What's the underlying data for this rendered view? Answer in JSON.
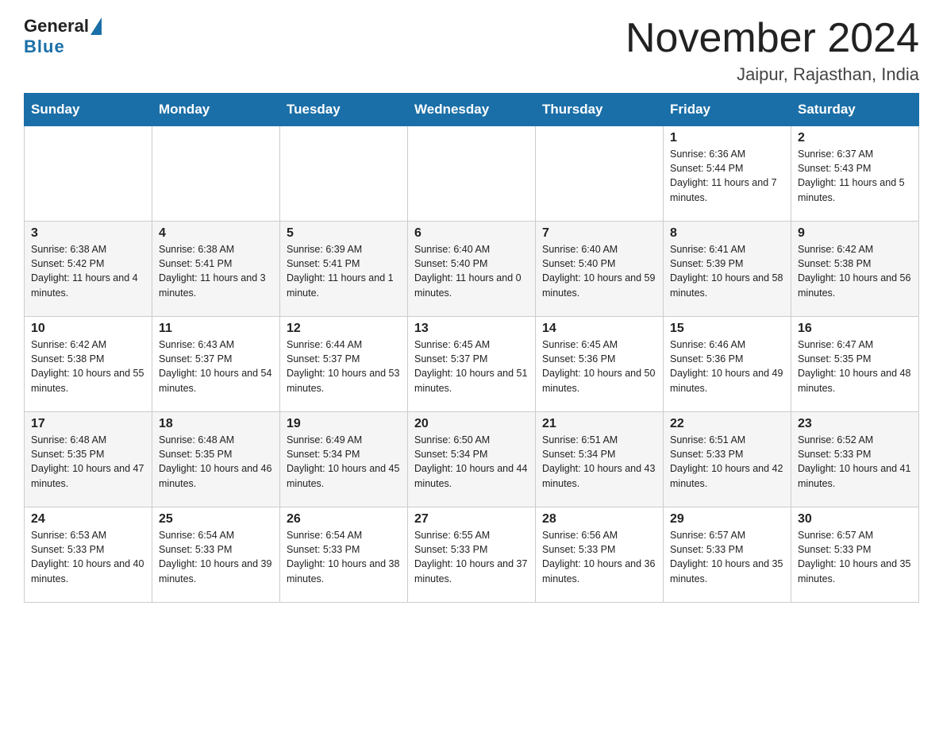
{
  "header": {
    "logo": {
      "general": "General",
      "blue": "Blue"
    },
    "title": "November 2024",
    "location": "Jaipur, Rajasthan, India"
  },
  "days_of_week": [
    "Sunday",
    "Monday",
    "Tuesday",
    "Wednesday",
    "Thursday",
    "Friday",
    "Saturday"
  ],
  "weeks": [
    [
      {
        "day": "",
        "info": ""
      },
      {
        "day": "",
        "info": ""
      },
      {
        "day": "",
        "info": ""
      },
      {
        "day": "",
        "info": ""
      },
      {
        "day": "",
        "info": ""
      },
      {
        "day": "1",
        "info": "Sunrise: 6:36 AM\nSunset: 5:44 PM\nDaylight: 11 hours and 7 minutes."
      },
      {
        "day": "2",
        "info": "Sunrise: 6:37 AM\nSunset: 5:43 PM\nDaylight: 11 hours and 5 minutes."
      }
    ],
    [
      {
        "day": "3",
        "info": "Sunrise: 6:38 AM\nSunset: 5:42 PM\nDaylight: 11 hours and 4 minutes."
      },
      {
        "day": "4",
        "info": "Sunrise: 6:38 AM\nSunset: 5:41 PM\nDaylight: 11 hours and 3 minutes."
      },
      {
        "day": "5",
        "info": "Sunrise: 6:39 AM\nSunset: 5:41 PM\nDaylight: 11 hours and 1 minute."
      },
      {
        "day": "6",
        "info": "Sunrise: 6:40 AM\nSunset: 5:40 PM\nDaylight: 11 hours and 0 minutes."
      },
      {
        "day": "7",
        "info": "Sunrise: 6:40 AM\nSunset: 5:40 PM\nDaylight: 10 hours and 59 minutes."
      },
      {
        "day": "8",
        "info": "Sunrise: 6:41 AM\nSunset: 5:39 PM\nDaylight: 10 hours and 58 minutes."
      },
      {
        "day": "9",
        "info": "Sunrise: 6:42 AM\nSunset: 5:38 PM\nDaylight: 10 hours and 56 minutes."
      }
    ],
    [
      {
        "day": "10",
        "info": "Sunrise: 6:42 AM\nSunset: 5:38 PM\nDaylight: 10 hours and 55 minutes."
      },
      {
        "day": "11",
        "info": "Sunrise: 6:43 AM\nSunset: 5:37 PM\nDaylight: 10 hours and 54 minutes."
      },
      {
        "day": "12",
        "info": "Sunrise: 6:44 AM\nSunset: 5:37 PM\nDaylight: 10 hours and 53 minutes."
      },
      {
        "day": "13",
        "info": "Sunrise: 6:45 AM\nSunset: 5:37 PM\nDaylight: 10 hours and 51 minutes."
      },
      {
        "day": "14",
        "info": "Sunrise: 6:45 AM\nSunset: 5:36 PM\nDaylight: 10 hours and 50 minutes."
      },
      {
        "day": "15",
        "info": "Sunrise: 6:46 AM\nSunset: 5:36 PM\nDaylight: 10 hours and 49 minutes."
      },
      {
        "day": "16",
        "info": "Sunrise: 6:47 AM\nSunset: 5:35 PM\nDaylight: 10 hours and 48 minutes."
      }
    ],
    [
      {
        "day": "17",
        "info": "Sunrise: 6:48 AM\nSunset: 5:35 PM\nDaylight: 10 hours and 47 minutes."
      },
      {
        "day": "18",
        "info": "Sunrise: 6:48 AM\nSunset: 5:35 PM\nDaylight: 10 hours and 46 minutes."
      },
      {
        "day": "19",
        "info": "Sunrise: 6:49 AM\nSunset: 5:34 PM\nDaylight: 10 hours and 45 minutes."
      },
      {
        "day": "20",
        "info": "Sunrise: 6:50 AM\nSunset: 5:34 PM\nDaylight: 10 hours and 44 minutes."
      },
      {
        "day": "21",
        "info": "Sunrise: 6:51 AM\nSunset: 5:34 PM\nDaylight: 10 hours and 43 minutes."
      },
      {
        "day": "22",
        "info": "Sunrise: 6:51 AM\nSunset: 5:33 PM\nDaylight: 10 hours and 42 minutes."
      },
      {
        "day": "23",
        "info": "Sunrise: 6:52 AM\nSunset: 5:33 PM\nDaylight: 10 hours and 41 minutes."
      }
    ],
    [
      {
        "day": "24",
        "info": "Sunrise: 6:53 AM\nSunset: 5:33 PM\nDaylight: 10 hours and 40 minutes."
      },
      {
        "day": "25",
        "info": "Sunrise: 6:54 AM\nSunset: 5:33 PM\nDaylight: 10 hours and 39 minutes."
      },
      {
        "day": "26",
        "info": "Sunrise: 6:54 AM\nSunset: 5:33 PM\nDaylight: 10 hours and 38 minutes."
      },
      {
        "day": "27",
        "info": "Sunrise: 6:55 AM\nSunset: 5:33 PM\nDaylight: 10 hours and 37 minutes."
      },
      {
        "day": "28",
        "info": "Sunrise: 6:56 AM\nSunset: 5:33 PM\nDaylight: 10 hours and 36 minutes."
      },
      {
        "day": "29",
        "info": "Sunrise: 6:57 AM\nSunset: 5:33 PM\nDaylight: 10 hours and 35 minutes."
      },
      {
        "day": "30",
        "info": "Sunrise: 6:57 AM\nSunset: 5:33 PM\nDaylight: 10 hours and 35 minutes."
      }
    ]
  ]
}
